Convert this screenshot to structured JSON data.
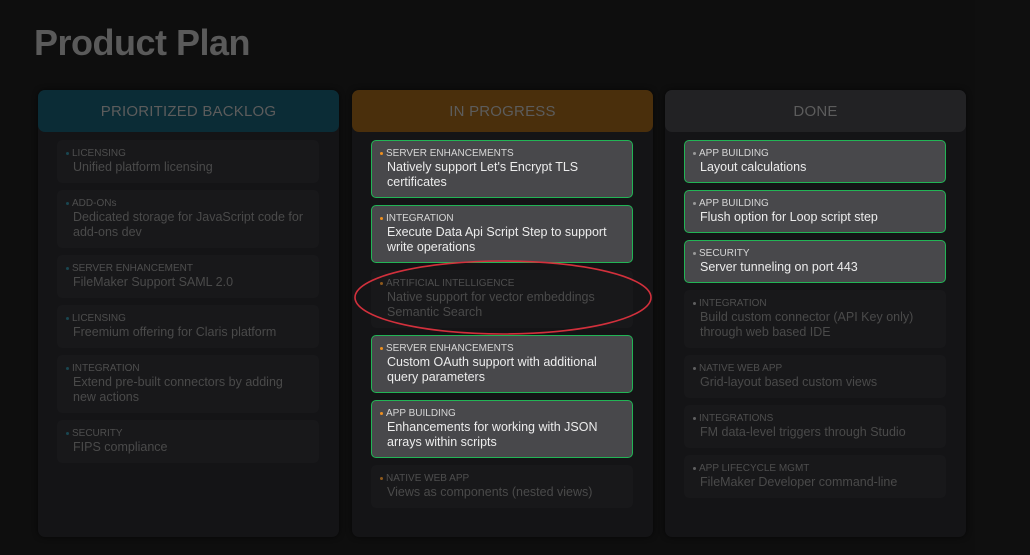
{
  "page": {
    "title": "Product Plan"
  },
  "colors": {
    "backlog_header": "#0b2c36",
    "in_progress_header": "#4a2f0c",
    "done_header": "#222224",
    "backlog_dot": "#1c6e80",
    "in_progress_dot": "#f0901e",
    "done_dot": "#9a9a9a",
    "active_border": "#22b455",
    "annotation": "#d2303c"
  },
  "columns": [
    {
      "id": "backlog",
      "title": "PRIORITIZED BACKLOG",
      "cards": [
        {
          "category": "LICENSING",
          "title": "Unified platform licensing",
          "active": false
        },
        {
          "category": "ADD-ONs",
          "title": "Dedicated storage for JavaScript code for add-ons dev",
          "active": false
        },
        {
          "category": "SERVER ENHANCEMENT",
          "title": "FileMaker Support SAML 2.0",
          "active": false
        },
        {
          "category": "LICENSING",
          "title": "Freemium offering for Claris platform",
          "active": false
        },
        {
          "category": "INTEGRATION",
          "title": "Extend pre-built connectors by adding new actions",
          "active": false
        },
        {
          "category": "SECURITY",
          "title": "FIPS compliance",
          "active": false
        }
      ]
    },
    {
      "id": "in-progress",
      "title": "IN PROGRESS",
      "cards": [
        {
          "category": "SERVER ENHANCEMENTS",
          "title": "Natively support Let's Encrypt TLS certificates",
          "active": true
        },
        {
          "category": "INTEGRATION",
          "title": "Execute Data Api Script Step to support write operations",
          "active": true
        },
        {
          "category": "ARTIFICIAL INTELLIGENCE",
          "title": "Native support for vector embeddings Semantic Search",
          "active": false,
          "highlighted": true
        },
        {
          "category": "SERVER ENHANCEMENTS",
          "title": "Custom OAuth support with additional query parameters",
          "active": true
        },
        {
          "category": "APP BUILDING",
          "title": "Enhancements for working with JSON arrays within scripts",
          "active": true
        },
        {
          "category": "NATIVE WEB APP",
          "title": "Views as components (nested views)",
          "active": false
        }
      ]
    },
    {
      "id": "done",
      "title": "DONE",
      "cards": [
        {
          "category": "APP BUILDING",
          "title": "Layout calculations",
          "active": true
        },
        {
          "category": "APP BUILDING",
          "title": "Flush option for Loop script step",
          "active": true
        },
        {
          "category": "SECURITY",
          "title": "Server tunneling on port 443",
          "active": true
        },
        {
          "category": "INTEGRATION",
          "title": "Build custom connector (API Key only) through web based IDE",
          "active": false
        },
        {
          "category": "NATIVE WEB APP",
          "title": "Grid-layout based custom views",
          "active": false
        },
        {
          "category": "INTEGRATIONS",
          "title": "FM data-level triggers through Studio",
          "active": false
        },
        {
          "category": "APP LIFECYCLE MGMT",
          "title": "FileMaker Developer command-line",
          "active": false
        }
      ]
    }
  ]
}
